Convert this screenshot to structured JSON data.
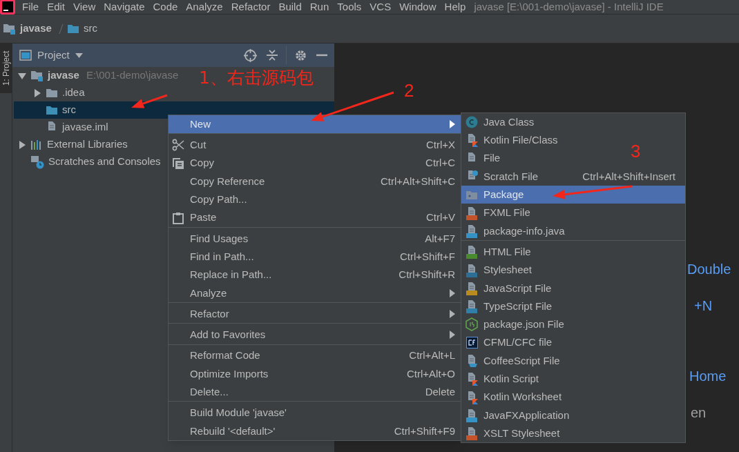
{
  "menu_bar": {
    "items": [
      "File",
      "Edit",
      "View",
      "Navigate",
      "Code",
      "Analyze",
      "Refactor",
      "Build",
      "Run",
      "Tools",
      "VCS",
      "Window",
      "Help"
    ],
    "title": "javase [E:\\001-demo\\javase] - IntelliJ IDE"
  },
  "breadcrumb": [
    {
      "label": "javase",
      "kind": "module"
    },
    {
      "label": "src",
      "kind": "source-folder"
    }
  ],
  "tool_strip": {
    "label": "1: Project"
  },
  "project_panel": {
    "title": "Project",
    "tree": [
      {
        "label": "javase",
        "hint": "E:\\001-demo\\javase",
        "kind": "module",
        "expanded": true,
        "selected": false,
        "children": [
          {
            "label": ".idea",
            "kind": "folder",
            "expanded": false,
            "selected": false
          },
          {
            "label": "src",
            "kind": "source-folder",
            "selected": true
          },
          {
            "label": "javase.iml",
            "kind": "file",
            "selected": false
          }
        ]
      },
      {
        "label": "External Libraries",
        "kind": "libraries",
        "expanded": false,
        "selected": false
      },
      {
        "label": "Scratches and Consoles",
        "kind": "scratches",
        "selected": false
      }
    ]
  },
  "editor_hints": [
    {
      "text": "Double",
      "kind": "shortcut"
    },
    {
      "text": "+N",
      "kind": "shortcut"
    },
    {
      "text": "Home",
      "kind": "shortcut"
    },
    {
      "text": "en",
      "kind": "text"
    }
  ],
  "context_menu": {
    "groups": [
      [
        {
          "label": "New",
          "submenu": true,
          "selected": true
        }
      ],
      [
        {
          "label": "Cut",
          "shortcut": "Ctrl+X",
          "submenu": false,
          "selected": false
        },
        {
          "label": "Copy",
          "shortcut": "Ctrl+C",
          "submenu": false,
          "selected": false
        },
        {
          "label": "Copy Reference",
          "shortcut": "Ctrl+Alt+Shift+C",
          "submenu": false,
          "selected": false
        },
        {
          "label": "Copy Path...",
          "submenu": false,
          "selected": false
        },
        {
          "label": "Paste",
          "shortcut": "Ctrl+V",
          "submenu": false,
          "selected": false
        }
      ],
      [
        {
          "label": "Find Usages",
          "shortcut": "Alt+F7",
          "submenu": false,
          "selected": false
        },
        {
          "label": "Find in Path...",
          "shortcut": "Ctrl+Shift+F",
          "submenu": false,
          "selected": false
        },
        {
          "label": "Replace in Path...",
          "shortcut": "Ctrl+Shift+R",
          "submenu": false,
          "selected": false
        },
        {
          "label": "Analyze",
          "submenu": true,
          "selected": false
        }
      ],
      [
        {
          "label": "Refactor",
          "submenu": true,
          "selected": false
        }
      ],
      [
        {
          "label": "Add to Favorites",
          "submenu": true,
          "selected": false
        }
      ],
      [
        {
          "label": "Reformat Code",
          "shortcut": "Ctrl+Alt+L",
          "submenu": false,
          "selected": false
        },
        {
          "label": "Optimize Imports",
          "shortcut": "Ctrl+Alt+O",
          "submenu": false,
          "selected": false
        },
        {
          "label": "Delete...",
          "shortcut": "Delete",
          "submenu": false,
          "selected": false
        }
      ],
      [
        {
          "label": "Build Module 'javase'",
          "submenu": false,
          "selected": false
        },
        {
          "label": "Rebuild '<default>'",
          "shortcut": "Ctrl+Shift+F9",
          "submenu": false,
          "selected": false
        }
      ]
    ]
  },
  "new_submenu": {
    "groups": [
      [
        {
          "label": "Java Class",
          "selected": false
        },
        {
          "label": "Kotlin File/Class",
          "selected": false
        },
        {
          "label": "File",
          "selected": false
        },
        {
          "label": "Scratch File",
          "shortcut": "Ctrl+Alt+Shift+Insert",
          "selected": false
        },
        {
          "label": "Package",
          "selected": true
        },
        {
          "label": "FXML File",
          "selected": false
        },
        {
          "label": "package-info.java",
          "selected": false
        }
      ],
      [
        {
          "label": "HTML File",
          "selected": false
        },
        {
          "label": "Stylesheet",
          "selected": false
        },
        {
          "label": "JavaScript File",
          "selected": false
        },
        {
          "label": "TypeScript File",
          "selected": false
        },
        {
          "label": "package.json File",
          "selected": false
        },
        {
          "label": "CFML/CFC file",
          "selected": false
        },
        {
          "label": "CoffeeScript File",
          "selected": false
        },
        {
          "label": "Kotlin Script",
          "selected": false
        },
        {
          "label": "Kotlin Worksheet",
          "selected": false
        },
        {
          "label": "JavaFXApplication",
          "selected": false
        },
        {
          "label": "XSLT Stylesheet",
          "selected": false
        }
      ]
    ]
  },
  "annotations": [
    {
      "text": "1、右击源码包"
    },
    {
      "text": "2"
    },
    {
      "text": "3"
    }
  ]
}
